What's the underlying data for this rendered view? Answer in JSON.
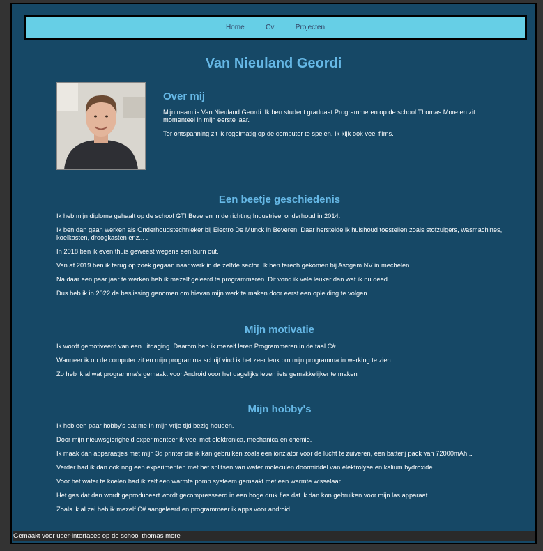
{
  "nav": {
    "items": [
      "Home",
      "Cv",
      "Projecten"
    ]
  },
  "title": "Van Nieuland Geordi",
  "about": {
    "heading": "Over mij",
    "paragraphs": [
      "Mijn naam is Van Nieuland Geordi. Ik ben student graduaat Programmeren op de school Thomas More en zit momenteel in mijn eerste jaar.",
      "Ter ontspanning zit ik regelmatig op de computer te spelen. Ik kijk ook veel films."
    ]
  },
  "history": {
    "heading": "Een beetje geschiedenis",
    "paragraphs": [
      "Ik heb mijn diploma gehaalt op de school GTI Beveren in de richting Industrieel onderhoud in 2014.",
      "Ik ben dan gaan werken als Onderhoudstechnieker bij Electro De Munck in Beveren. Daar herstelde ik huishoud toestellen zoals stofzuigers, wasmachines, koelkasten, droogkasten enz... .",
      "In 2018 ben ik even thuis geweest wegens een burn out.",
      "Van af 2019 ben ik terug op zoek gegaan naar werk in de zelfde sector. Ik ben terech gekomen bij Asogem NV in mechelen.",
      "Na daar een paar jaar te werken heb ik mezelf geleerd te programmeren. Dit vond ik vele leuker dan wat ik nu deed",
      "Dus heb ik in 2022 de beslissing genomen om hievan mijn werk te maken door eerst een opleiding te volgen."
    ]
  },
  "motivation": {
    "heading": "Mijn motivatie",
    "paragraphs": [
      "Ik wordt gemotiveerd van een uitdaging. Daarom heb ik mezelf leren Programmeren in de taal C#.",
      "Wanneer ik op de computer zit en mijn programma schrijf vind ik het zeer leuk om mijn programma in werking te zien.",
      "Zo heb ik al wat programma's gemaakt voor Android voor het dagelijks leven iets gemakkelijker te maken"
    ]
  },
  "hobbies": {
    "heading": "Mijn hobby's",
    "paragraphs": [
      "Ik heb een paar hobby's dat me in mijn vrije tijd bezig houden.",
      "Door mijn nieuwsgierigheid experimenteer ik veel met elektronica, mechanica en chemie.",
      "Ik maak dan apparaatjes met mijn 3d printer die ik kan gebruiken zoals een ionziator voor de lucht te zuiveren, een batterij pack van 72000mAh...",
      "Verder had ik dan ook nog een experimenten met het splitsen van water moleculen doormiddel van elektrolyse en kalium hydroxide.",
      "Voor het water te koelen had ik zelf een warmte pomp systeem gemaakt met een warmte wisselaar.",
      "Het gas dat dan wordt geproduceert wordt gecompresseerd in een hoge druk fles dat ik dan kon gebruiken voor mijn las apparaat.",
      "Zoals ik al zei heb ik mezelf C# aangeleerd en programmeer ik apps voor android."
    ]
  },
  "footer": "Gemaakt voor user-interfaces op de school thomas more"
}
